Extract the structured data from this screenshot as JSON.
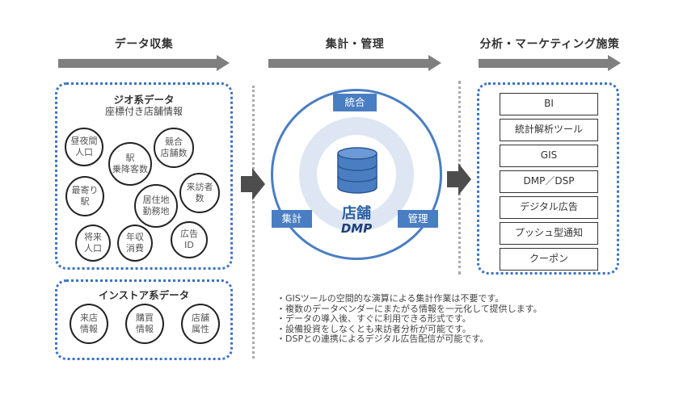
{
  "sections": [
    {
      "title": "データ収集"
    },
    {
      "title": "集計・管理"
    },
    {
      "title": "分析・マーケティング施策"
    }
  ],
  "geo_group": {
    "title": "ジオ系データ",
    "subtitle": "座標付き店舗情報",
    "items": [
      "昼夜間\n人口",
      "駅\n乗降客数",
      "競合\n店舗数",
      "最寄り\n駅",
      "居住地\n勤務地",
      "来訪者\n数",
      "将来\n人口",
      "年収\n消費",
      "広告\nID"
    ]
  },
  "instore_group": {
    "title": "インストア系データ",
    "items": [
      "来店\n情報",
      "購買\n情報",
      "店舗\n属性"
    ]
  },
  "dmp": {
    "title": "店舗",
    "subtitle": "DMP",
    "tags": {
      "top": "統合",
      "left": "集計",
      "right": "管理"
    },
    "icon": "database-icon"
  },
  "tools": [
    "BI",
    "統計解析ツール",
    "GIS",
    "DMP／DSP",
    "デジタル広告",
    "プッシュ型通知",
    "クーポン"
  ],
  "notes": [
    "・GISツールの空間的な演算による集計作業は不要です。",
    "・複数のデータベンダーにまたがる情報を一元化して提供します。",
    "・データの導入後、すぐに利用できる形式です。",
    "・設備投資をしなくとも来訪者分析が可能です。",
    "・DSPとの連携によるデジタル広告配信が可能です。"
  ],
  "colors": {
    "accent_blue": "#4a7ec2",
    "dotted_border": "#3a73c4",
    "arrow_gray": "#7f7f7f",
    "block_arrow": "#4d4d4d",
    "halo": "#dde6f2"
  }
}
